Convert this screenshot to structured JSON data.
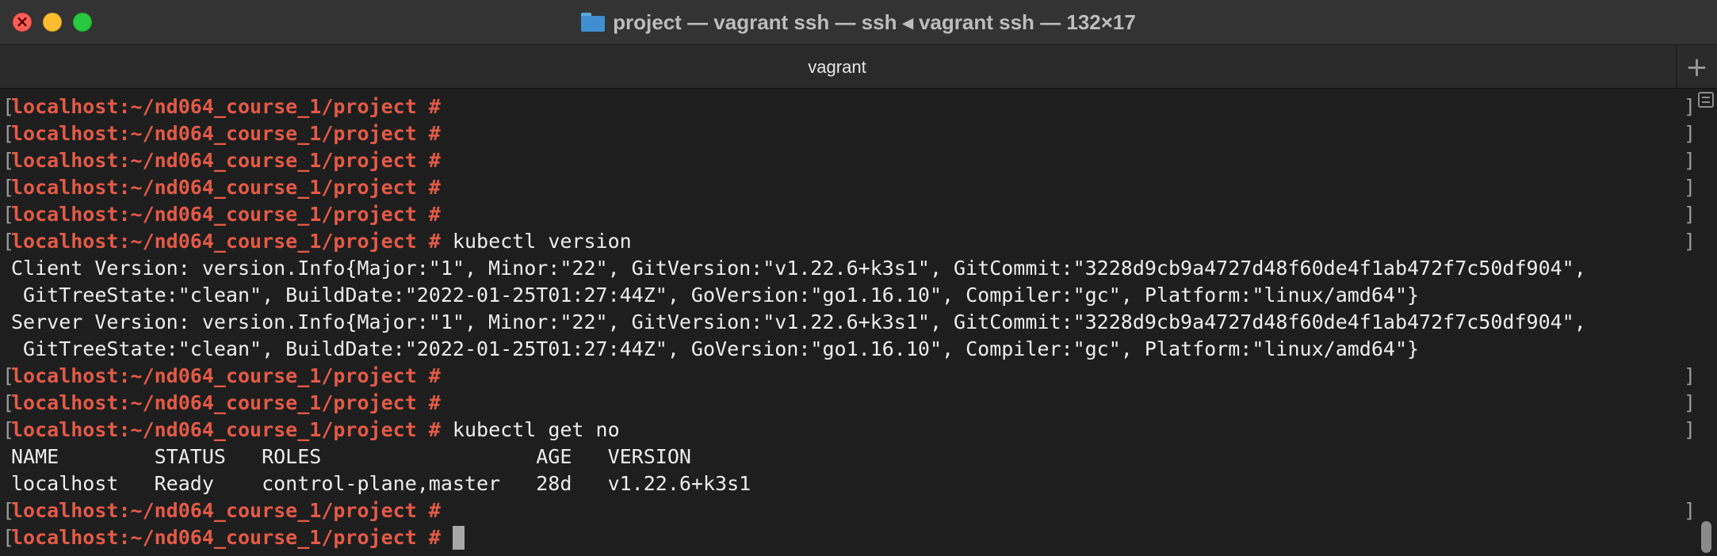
{
  "window": {
    "title": "project — vagrant ssh — ssh ◂ vagrant ssh — 132×17",
    "tab_label": "vagrant",
    "new_tab_label": "+"
  },
  "terminal": {
    "prompt": "localhost:~/nd064_course_1/project #",
    "lines": [
      {
        "kind": "prompt",
        "cmd": ""
      },
      {
        "kind": "prompt",
        "cmd": ""
      },
      {
        "kind": "prompt",
        "cmd": ""
      },
      {
        "kind": "prompt",
        "cmd": ""
      },
      {
        "kind": "prompt",
        "cmd": ""
      },
      {
        "kind": "prompt",
        "cmd": " kubectl version"
      },
      {
        "kind": "output",
        "text": "Client Version: version.Info{Major:\"1\", Minor:\"22\", GitVersion:\"v1.22.6+k3s1\", GitCommit:\"3228d9cb9a4727d48f60de4f1ab472f7c50df904\","
      },
      {
        "kind": "output",
        "text": " GitTreeState:\"clean\", BuildDate:\"2022-01-25T01:27:44Z\", GoVersion:\"go1.16.10\", Compiler:\"gc\", Platform:\"linux/amd64\"}"
      },
      {
        "kind": "output",
        "text": "Server Version: version.Info{Major:\"1\", Minor:\"22\", GitVersion:\"v1.22.6+k3s1\", GitCommit:\"3228d9cb9a4727d48f60de4f1ab472f7c50df904\","
      },
      {
        "kind": "output",
        "text": " GitTreeState:\"clean\", BuildDate:\"2022-01-25T01:27:44Z\", GoVersion:\"go1.16.10\", Compiler:\"gc\", Platform:\"linux/amd64\"}"
      },
      {
        "kind": "prompt",
        "cmd": ""
      },
      {
        "kind": "prompt",
        "cmd": ""
      },
      {
        "kind": "prompt",
        "cmd": " kubectl get no"
      },
      {
        "kind": "output",
        "text": "NAME        STATUS   ROLES                  AGE   VERSION"
      },
      {
        "kind": "output",
        "text": "localhost   Ready    control-plane,master   28d   v1.22.6+k3s1"
      },
      {
        "kind": "prompt",
        "cmd": ""
      },
      {
        "kind": "prompt",
        "cmd": " ",
        "cursor": true,
        "current": true
      }
    ]
  },
  "icons": {
    "folder": "folder-icon",
    "outline": "outline-view-icon",
    "cursor": "block-cursor"
  },
  "colors": {
    "prompt": "#e35a46",
    "text": "#ededed",
    "background": "#1e1e1e"
  }
}
